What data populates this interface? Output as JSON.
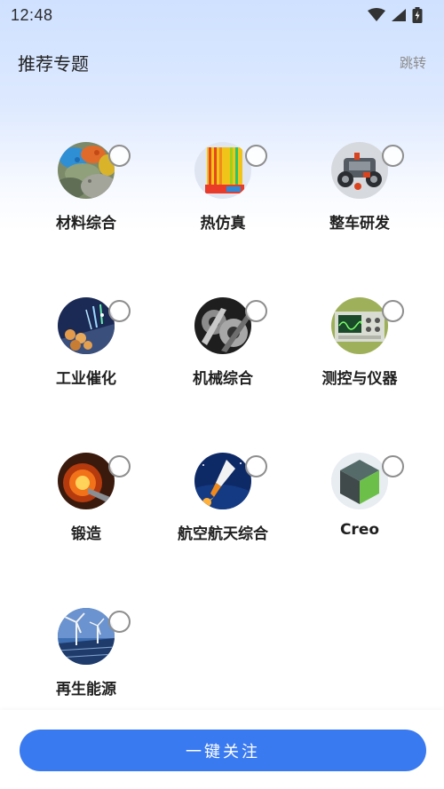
{
  "status_bar": {
    "time": "12:48"
  },
  "header": {
    "title": "推荐专题",
    "skip_label": "跳转"
  },
  "topics": [
    {
      "label": "材料综合",
      "icon": "materials-icon"
    },
    {
      "label": "热仿真",
      "icon": "thermal-sim-icon"
    },
    {
      "label": "整车研发",
      "icon": "vehicle-rd-icon"
    },
    {
      "label": "工业催化",
      "icon": "industrial-catalysis-icon"
    },
    {
      "label": "机械综合",
      "icon": "mechanical-icon"
    },
    {
      "label": "测控与仪器",
      "icon": "instrument-icon"
    },
    {
      "label": "锻造",
      "icon": "forging-icon"
    },
    {
      "label": "航空航天综合",
      "icon": "aerospace-icon"
    },
    {
      "label": "Creo",
      "icon": "creo-cube-icon"
    },
    {
      "label": "再生能源",
      "icon": "renewable-energy-icon"
    }
  ],
  "bottom": {
    "follow_all_label": "一键关注"
  },
  "colors": {
    "accent": "#3a7af1",
    "gradient_top": "#cfe1ff"
  }
}
